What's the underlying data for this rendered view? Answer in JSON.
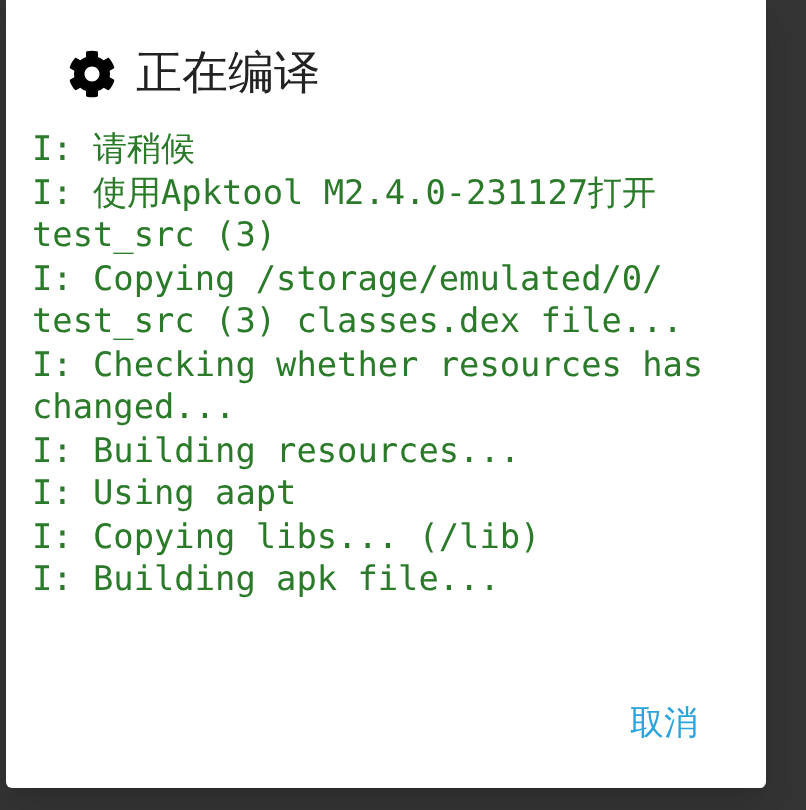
{
  "dialog": {
    "title": "正在编译",
    "log": [
      "I: 请稍候",
      "I: 使用Apktool M2.4.0-231127打开",
      "test_src (3)",
      "I: Copying /storage/emulated/0/",
      "test_src (3) classes.dex file...",
      "I: Checking whether resources has",
      "changed...",
      "I: Building resources...",
      "I: Using aapt",
      "I: Copying libs... (/lib)",
      "I: Building apk file..."
    ],
    "buttons": [
      "取消"
    ]
  }
}
